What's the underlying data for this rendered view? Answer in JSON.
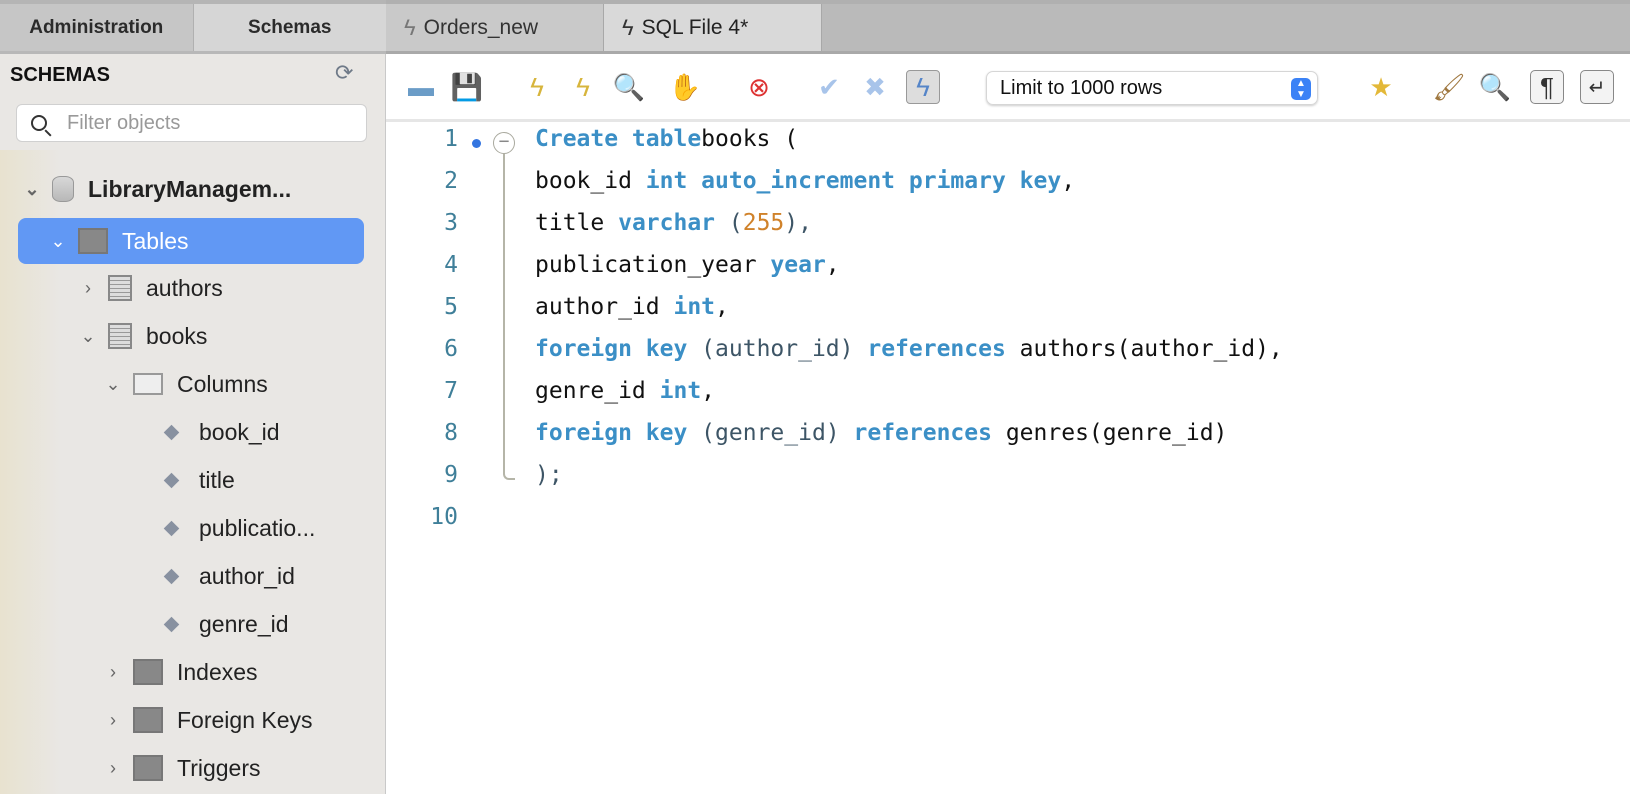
{
  "sidebar": {
    "tabs": [
      "Administration",
      "Schemas"
    ],
    "heading": "SCHEMAS",
    "filter_placeholder": "Filter objects",
    "tree": {
      "schema": "LibraryManagem...",
      "tables": "Tables",
      "items": [
        "authors",
        "books"
      ],
      "columns_label": "Columns",
      "columns": [
        "book_id",
        "title",
        "publicatio...",
        "author_id",
        "genre_id"
      ],
      "groups": [
        "Indexes",
        "Foreign Keys",
        "Triggers"
      ]
    }
  },
  "editor_tabs": [
    "Orders_new",
    "SQL File 4*"
  ],
  "toolbar": {
    "limit": "Limit to 1000 rows"
  },
  "code": {
    "line_numbers": [
      "1",
      "2",
      "3",
      "4",
      "5",
      "6",
      "7",
      "8",
      "9",
      "10"
    ],
    "lines": [
      [
        [
          "kw",
          "Create table"
        ],
        [
          "",
          "books ("
        ]
      ],
      [
        [
          "",
          "book_id "
        ],
        [
          "kw",
          "int auto_increment primary key"
        ],
        [
          "",
          ","
        ]
      ],
      [
        [
          "",
          "title "
        ],
        [
          "kw",
          "varchar"
        ],
        [
          "p",
          " ("
        ],
        [
          "num",
          "255"
        ],
        [
          "p",
          "),"
        ]
      ],
      [
        [
          "",
          "publication_year "
        ],
        [
          "kw",
          "year"
        ],
        [
          "",
          ","
        ]
      ],
      [
        [
          "",
          "author_id "
        ],
        [
          "kw",
          "int"
        ],
        [
          "",
          ","
        ]
      ],
      [
        [
          "kw",
          "foreign key"
        ],
        [
          "p",
          " (author_id) "
        ],
        [
          "kw",
          "references"
        ],
        [
          "",
          ": authors(author_id),"
        ]
      ],
      [
        [
          "",
          "genre_id "
        ],
        [
          "kw",
          "int"
        ],
        [
          "",
          ","
        ]
      ],
      [
        [
          "kw",
          "foreign key"
        ],
        [
          "p",
          " (genre_id) "
        ],
        [
          "kw",
          "references"
        ],
        [
          "",
          ": genres(genre_id)"
        ]
      ],
      [
        [
          "p",
          ");"
        ]
      ],
      []
    ]
  }
}
